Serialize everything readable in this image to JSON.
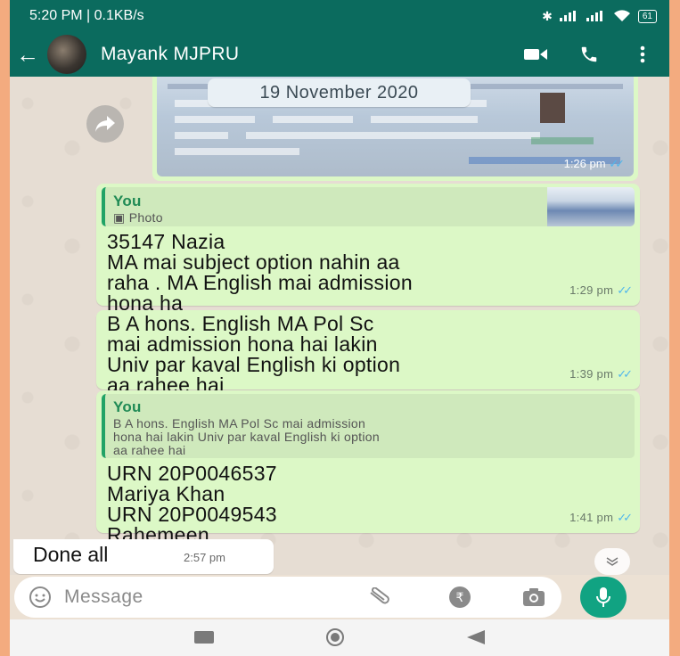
{
  "status_bar": {
    "left": "5:20 PM | 0.1KB/s",
    "battery": "61"
  },
  "header": {
    "contact_name": "Mayank MJPRU"
  },
  "chat": {
    "date_label": "19 November 2020",
    "photo_message": {
      "time": "1:26 pm"
    },
    "messages": [
      {
        "quote_author": "You",
        "quote_text": "Photo",
        "lines": [
          "35147 Nazia",
          "MA mai  subject option nahin aa",
          "raha . MA English mai admission",
          "hona ha"
        ],
        "time": "1:29 pm"
      },
      {
        "lines": [
          "B  A hons. English  MA Pol Sc",
          "mai admission hona hai lakin",
          "Univ par kaval English ki option",
          "aa rahee hai"
        ],
        "time": "1:39 pm"
      },
      {
        "quote_author": "You",
        "quote_lines": [
          "B  A hons. English  MA Pol Sc mai admission",
          "hona hai lakin Univ par kaval English ki option",
          "aa rahee hai"
        ],
        "lines": [
          "URN 20P0046537",
          "Mariya Khan",
          "URN 20P0049543",
          "Rahemeen"
        ],
        "time": "1:41 pm"
      }
    ],
    "incoming": {
      "text": "Done all",
      "time": "2:57 pm"
    }
  },
  "composer": {
    "placeholder": "Message"
  },
  "colors": {
    "header": "#0b6b5e",
    "outgoing": "#dcf8c6",
    "accent": "#11a382"
  }
}
